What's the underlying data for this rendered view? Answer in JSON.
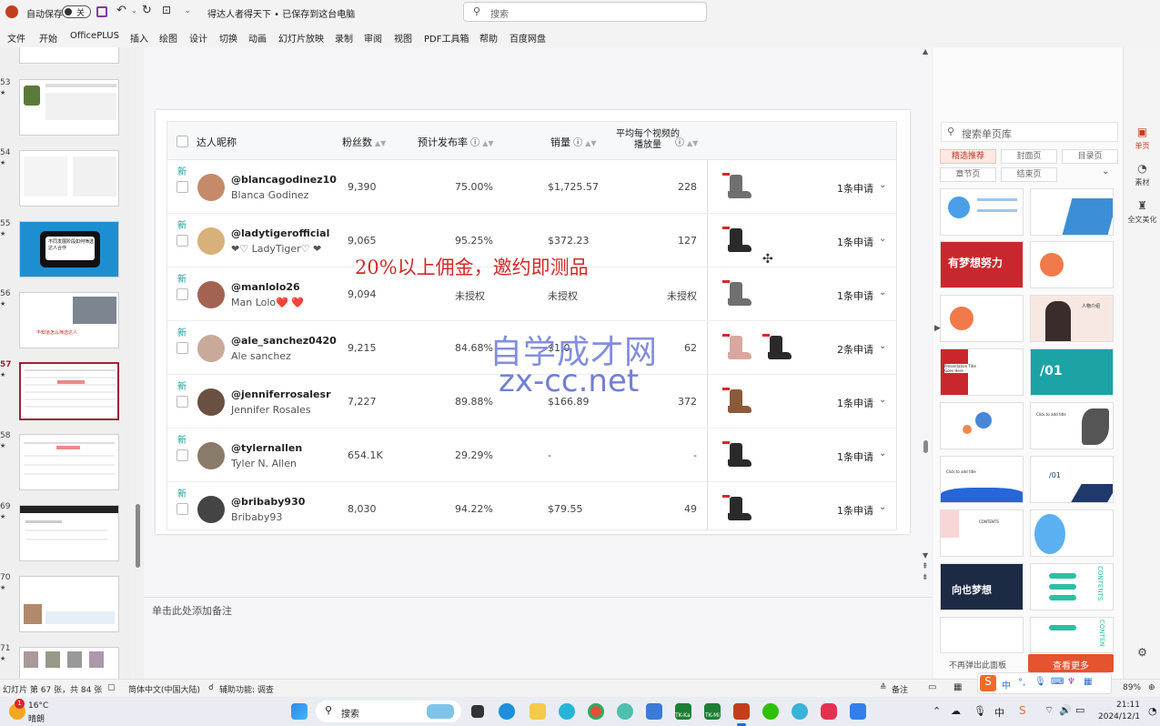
{
  "titlebar": {
    "autosave_label": "自动保存",
    "autosave_state": "关",
    "doc_title": "得达人者得天下 • 已保存到这台电脑",
    "search_placeholder": "搜索"
  },
  "menu": [
    "文件",
    "开始",
    "OfficePLUS",
    "插入",
    "绘图",
    "设计",
    "切换",
    "动画",
    "幻灯片放映",
    "录制",
    "审阅",
    "视图",
    "PDF工具箱",
    "帮助",
    "百度网盘"
  ],
  "thumbnails": [
    {
      "num": "53",
      "star": "★"
    },
    {
      "num": "54",
      "star": "★"
    },
    {
      "num": "55",
      "star": "★"
    },
    {
      "num": "56",
      "star": "★"
    },
    {
      "num": "57",
      "star": "★"
    },
    {
      "num": "58",
      "star": "★"
    },
    {
      "num": "69",
      "star": "★"
    },
    {
      "num": "70",
      "star": "★"
    },
    {
      "num": "71",
      "star": "★"
    }
  ],
  "thumb55_text": "不同发展阶段如何筛选达人合作",
  "thumb56_text": "不知道怎么筛选达人",
  "table": {
    "headers": {
      "name": "达人昵称",
      "followers": "粉丝数",
      "post_rate": "预计发布率",
      "sales": "销量",
      "avg_views": "平均每个视频的播放量"
    },
    "rows": [
      {
        "tag": "新",
        "handle": "@blancagodinez10",
        "name": "Blanca Godinez",
        "followers": "9,390",
        "rate": "75.00%",
        "sales": "$1,725.57",
        "views": "228",
        "apply": "1条申请",
        "shoes": [
          "grey"
        ]
      },
      {
        "tag": "新",
        "handle": "@ladytigerofficial",
        "name": "❤♡ LadyTiger♡ ❤",
        "followers": "9,065",
        "rate": "95.25%",
        "sales": "$372.23",
        "views": "127",
        "apply": "1条申请",
        "shoes": [
          "black"
        ]
      },
      {
        "tag": "新",
        "handle": "@manlolo26",
        "name": "Man Lolo❤️ ❤️",
        "followers": "9,094",
        "rate": "未授权",
        "sales": "未授权",
        "views": "未授权",
        "apply": "1条申请",
        "shoes": [
          "grey"
        ]
      },
      {
        "tag": "新",
        "handle": "@ale_sanchez0420",
        "name": "Ale sanchez",
        "followers": "9,215",
        "rate": "84.68%",
        "sales": "$1,0",
        "views": "62",
        "apply": "2条申请",
        "shoes": [
          "pink",
          "black"
        ]
      },
      {
        "tag": "新",
        "handle": "@jenniferrosalesr",
        "name": "Jennifer Rosales",
        "followers": "7,227",
        "rate": "89.88%",
        "sales": "$166.89",
        "views": "372",
        "apply": "1条申请",
        "shoes": [
          "brown"
        ]
      },
      {
        "tag": "新",
        "handle": "@tylernallen",
        "name": "Tyler N. Allen",
        "followers": "654.1K",
        "rate": "29.29%",
        "sales": "-",
        "views": "-",
        "apply": "1条申请",
        "shoes": [
          "black"
        ]
      },
      {
        "tag": "新",
        "handle": "@bribaby930",
        "name": "Bribaby93",
        "followers": "8,030",
        "rate": "94.22%",
        "sales": "$79.55",
        "views": "49",
        "apply": "1条申请",
        "shoes": [
          "black"
        ]
      }
    ]
  },
  "overlay_red_text": "20%以上佣金，邀约即测品",
  "watermark": {
    "line1": "自学成才网",
    "line2": "zx-cc.net"
  },
  "notes_placeholder": "单击此处添加备注",
  "right_pane": {
    "search_placeholder": "搜索单页库",
    "tabs": [
      "精选推荐",
      "封面页",
      "目录页",
      "章节页",
      "结束页"
    ],
    "footer_hint": "不再弹出此面板",
    "more_button": "查看更多",
    "template_texts": {
      "t1": "有梦想努力",
      "t2": "人物介绍",
      "t3": "Presentation Title Goes Here",
      "t4": "/01",
      "t5": "Click to add title",
      "t6": "Click to add title",
      "t7": "/01",
      "t8": "CONTENTS",
      "t9": "向也梦想",
      "t10": "CONTENTS",
      "t11": "CONTEN"
    }
  },
  "right_bar": [
    {
      "label": "单页"
    },
    {
      "label": "素材"
    },
    {
      "label": "全文美化"
    }
  ],
  "statusbar": {
    "slide_info": "幻灯片 第 67 张，共 84 张",
    "language": "简体中文(中国大陆)",
    "accessibility": "辅助功能: 调查",
    "notes": "备注",
    "zoom": "89%"
  },
  "taskbar": {
    "weather_temp": "16°C",
    "weather_desc": "晴朗",
    "weather_badge": "1",
    "search": "搜索",
    "ime": "中",
    "time": "21:11",
    "date": "2024/12/1",
    "app_label_1": "TK-Ka",
    "app_label_2": "TK-Mi"
  },
  "colors": {
    "accent_red": "#d62828",
    "new_tag": "#1aa09a",
    "active_thumb": "#9b2335",
    "more_button": "#e5532f"
  }
}
